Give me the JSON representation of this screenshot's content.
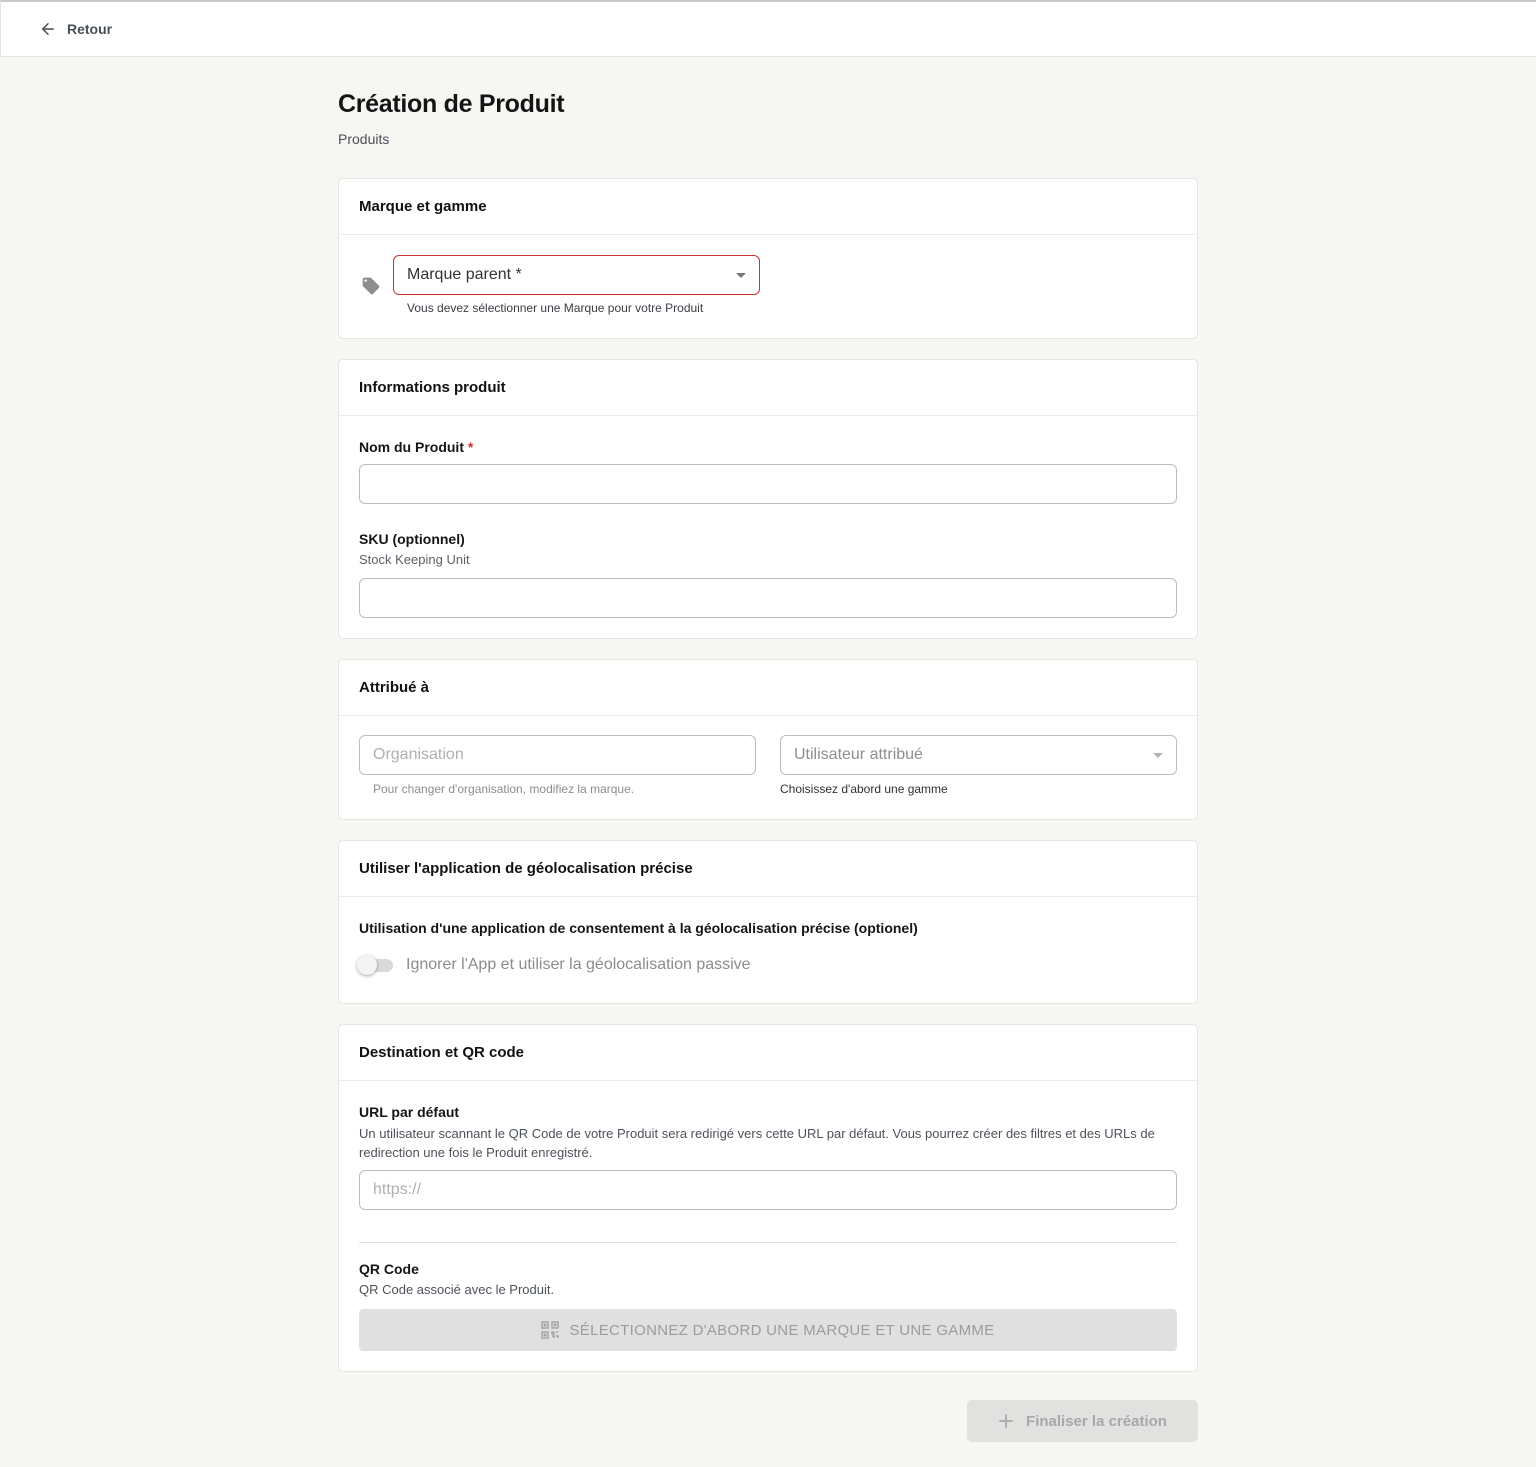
{
  "header": {
    "back_label": "Retour",
    "back_icon": "arrow-left-icon"
  },
  "page": {
    "title": "Création de Produit",
    "subtitle": "Produits"
  },
  "brand_section": {
    "title": "Marque et gamme",
    "icon": "tag-icon",
    "select_label": "Marque parent *",
    "error_text": "Vous devez sélectionner une Marque pour votre Produit",
    "error_color": "#c63434"
  },
  "product_info": {
    "title": "Informations produit",
    "name_label": "Nom du Produit",
    "required_mark": "*",
    "name_value": "",
    "sku_label": "SKU (optionnel)",
    "sku_hint": "Stock Keeping Unit",
    "sku_value": ""
  },
  "assigned": {
    "title": "Attribué à",
    "organisation_placeholder": "Organisation",
    "organisation_hint": "Pour changer d'organisation, modifiez la marque.",
    "user_placeholder": "Utilisateur attribué",
    "user_hint": "Choisissez d'abord une gamme"
  },
  "geoloc": {
    "title": "Utiliser l'application de géolocalisation précise",
    "field_label": "Utilisation d'une application de consentement à la géolocalisation précise (optionel)",
    "toggle_label": "Ignorer l'App et utiliser la géolocalisation passive",
    "toggle_on": false
  },
  "destination": {
    "title": "Destination et QR code",
    "url_label": "URL par défaut",
    "url_hint": "Un utilisateur scannant le QR Code de votre Produit sera redirigé vers cette URL par défaut. Vous pourrez créer des filtres et des URLs de redirection une fois le Produit enregistré.",
    "url_placeholder": "https://",
    "qr_label": "QR Code",
    "qr_hint": "QR Code associé avec le Produit.",
    "qr_button": "SÉLECTIONNEZ D'ABORD UNE MARQUE ET UNE GAMME",
    "qr_icon": "qr-code-icon"
  },
  "footer": {
    "finish_label": "Finaliser la création",
    "finish_icon": "plus-icon"
  }
}
